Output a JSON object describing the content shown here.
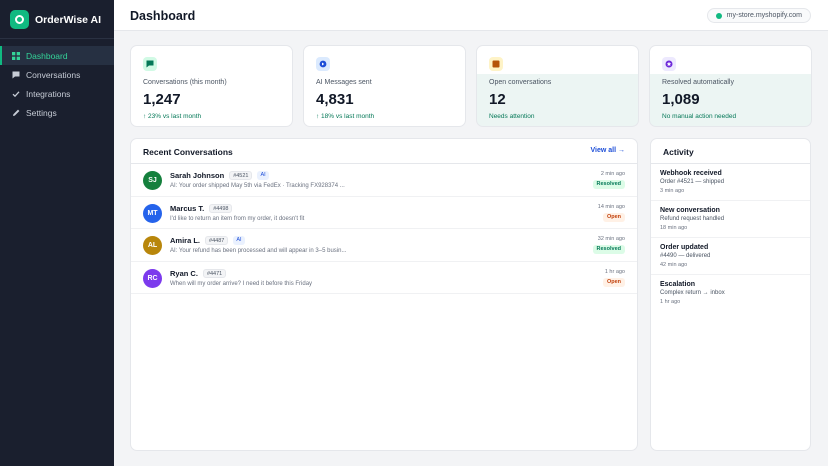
{
  "brand": {
    "name": "OrderWise AI"
  },
  "sidebar": {
    "items": [
      {
        "label": "Dashboard",
        "icon": "grid-icon",
        "active": true
      },
      {
        "label": "Conversations",
        "icon": "chat-icon",
        "active": false
      },
      {
        "label": "Integrations",
        "icon": "check-icon",
        "active": false
      },
      {
        "label": "Settings",
        "icon": "pencil-icon",
        "active": false
      }
    ]
  },
  "header": {
    "title": "Dashboard",
    "store": "my-store.myshopify.com"
  },
  "stats": [
    {
      "label": "Conversations (this month)",
      "value": "1,247",
      "sub": "↑ 23% vs last month",
      "icon": "chat-icon",
      "icon_color": "#047857",
      "icon_bg": "#d1fae5"
    },
    {
      "label": "AI Messages sent",
      "value": "4,831",
      "sub": "↑ 18% vs last month",
      "icon": "robot-icon",
      "icon_color": "#1d4ed8",
      "icon_bg": "#dbeafe"
    },
    {
      "label": "Open conversations",
      "value": "12",
      "sub": "Needs attention",
      "icon": "square-icon",
      "icon_color": "#b45309",
      "icon_bg": "#fef3c7"
    },
    {
      "label": "Resolved automatically",
      "value": "1,089",
      "sub": "No manual action needed",
      "icon": "badge-icon",
      "icon_color": "#6d28d9",
      "icon_bg": "#ede9fe"
    }
  ],
  "recent": {
    "title": "Recent Conversations",
    "view_all": "View all →",
    "items": [
      {
        "initials": "SJ",
        "avatar_color": "#15803d",
        "name": "Sarah Johnson",
        "id": "#4521",
        "ai": "AI",
        "preview": "AI: Your order shipped May 5th via FedEx · Tracking FX928374 ...",
        "time": "2 min ago",
        "status": "Resolved",
        "status_type": "resolved"
      },
      {
        "initials": "MT",
        "avatar_color": "#2563eb",
        "name": "Marcus T.",
        "id": "#4498",
        "ai": "",
        "preview": "I'd like to return an item from my order, it doesn't fit",
        "time": "14 min ago",
        "status": "Open",
        "status_type": "open"
      },
      {
        "initials": "AL",
        "avatar_color": "#b8860b",
        "name": "Amira L.",
        "id": "#4487",
        "ai": "AI",
        "preview": "AI: Your refund has been processed and will appear in 3–5 busin...",
        "time": "32 min ago",
        "status": "Resolved",
        "status_type": "resolved"
      },
      {
        "initials": "RC",
        "avatar_color": "#7c3aed",
        "name": "Ryan C.",
        "id": "#4471",
        "ai": "",
        "preview": "When will my order arrive? I need it before this Friday",
        "time": "1 hr ago",
        "status": "Open",
        "status_type": "open"
      }
    ]
  },
  "activity": {
    "title": "Activity",
    "items": [
      {
        "title": "Webhook received",
        "detail": "Order #4521 — shipped",
        "time": "3 min ago"
      },
      {
        "title": "New conversation",
        "detail": "Refund request handled",
        "time": "18 min ago"
      },
      {
        "title": "Order updated",
        "detail": "#4490 — delivered",
        "time": "42 min ago"
      },
      {
        "title": "Escalation",
        "detail": "Complex return → inbox",
        "time": "1 hr ago"
      }
    ]
  }
}
